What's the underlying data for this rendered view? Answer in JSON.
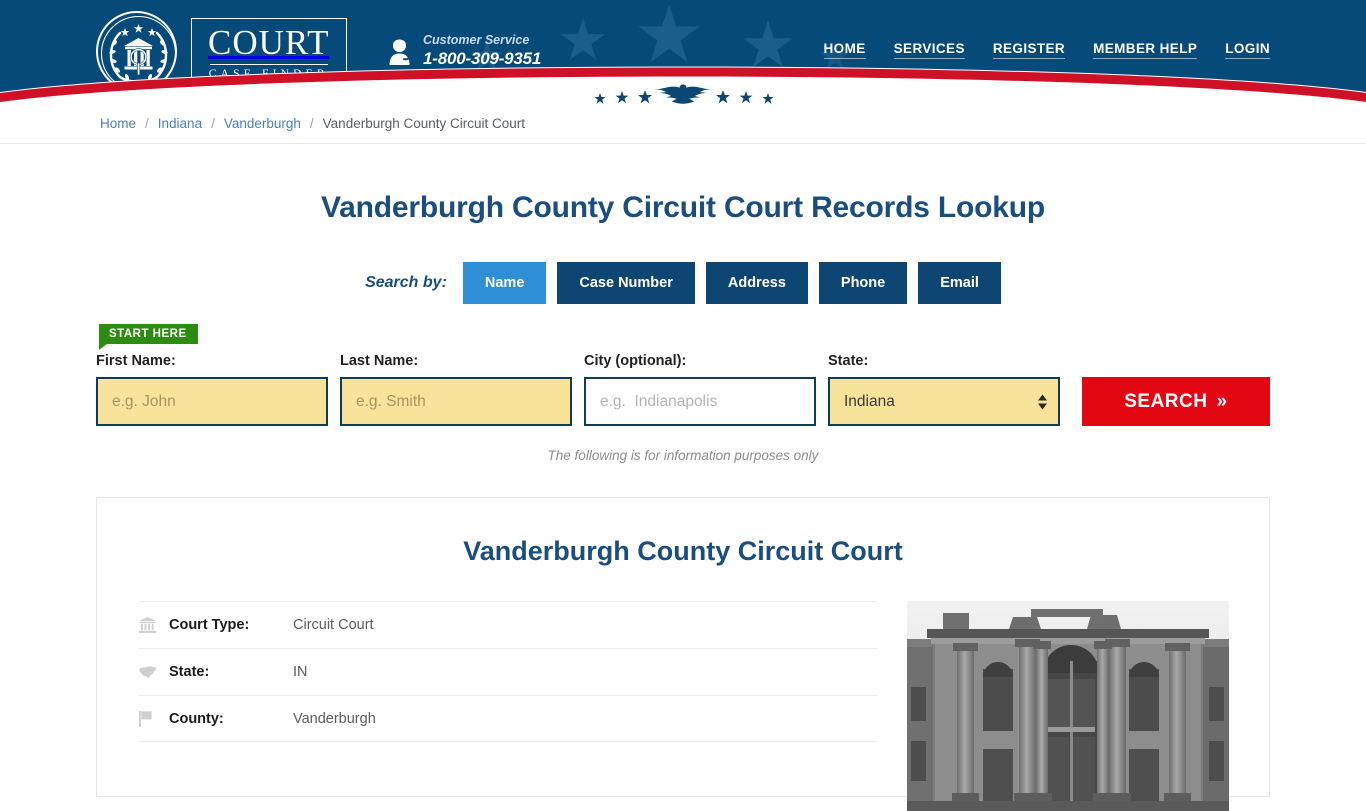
{
  "header": {
    "logo": {
      "main": "COURT",
      "sub": "CASE FINDER",
      "seal_icon": "court-seal-icon"
    },
    "customer_service": {
      "label": "Customer Service",
      "phone": "1-800-309-9351",
      "icon": "headset-support-icon"
    },
    "nav": [
      {
        "label": "HOME"
      },
      {
        "label": "SERVICES"
      },
      {
        "label": "REGISTER"
      },
      {
        "label": "MEMBER HELP"
      },
      {
        "label": "LOGIN"
      }
    ],
    "colors": {
      "navy": "#064a7a",
      "red": "#ce1126",
      "star": "#1b5d8c"
    }
  },
  "breadcrumb": {
    "items": [
      {
        "label": "Home",
        "current": false
      },
      {
        "label": "Indiana",
        "current": false
      },
      {
        "label": "Vanderburgh",
        "current": false
      },
      {
        "label": "Vanderburgh County Circuit Court",
        "current": true
      }
    ],
    "separator": "/"
  },
  "main": {
    "page_title": "Vanderburgh County Circuit Court Records Lookup",
    "search_by_label": "Search by:",
    "tabs": [
      {
        "label": "Name",
        "active": true
      },
      {
        "label": "Case Number",
        "active": false
      },
      {
        "label": "Address",
        "active": false
      },
      {
        "label": "Phone",
        "active": false
      },
      {
        "label": "Email",
        "active": false
      }
    ],
    "start_badge": "START HERE",
    "form": {
      "first_name": {
        "label": "First Name:",
        "placeholder": "e.g. John",
        "value": ""
      },
      "last_name": {
        "label": "Last Name:",
        "placeholder": "e.g. Smith",
        "value": ""
      },
      "city": {
        "label": "City (optional):",
        "placeholder": "e.g.  Indianapolis",
        "value": ""
      },
      "state": {
        "label": "State:",
        "selected": "Indiana"
      },
      "search_button": "SEARCH",
      "search_button_chevron": "»"
    },
    "disclaimer": "The following is for information purposes only"
  },
  "card": {
    "title": "Vanderburgh County Circuit Court",
    "rows": [
      {
        "icon": "bank-icon",
        "label": "Court Type:",
        "value": "Circuit Court"
      },
      {
        "icon": "us-map-icon",
        "label": "State:",
        "value": "IN"
      },
      {
        "icon": "flag-icon",
        "label": "County:",
        "value": "Vanderburgh"
      }
    ],
    "photo_alt": "courthouse-photo"
  },
  "colors": {
    "accent_blue": "#1a4d80",
    "tab_active": "#2e8fd6",
    "tab_inactive": "#0d4673",
    "search_red": "#e30613",
    "badge_green": "#2e8b12",
    "field_yellow": "#f8e39a",
    "field_border": "#0f3d52"
  }
}
